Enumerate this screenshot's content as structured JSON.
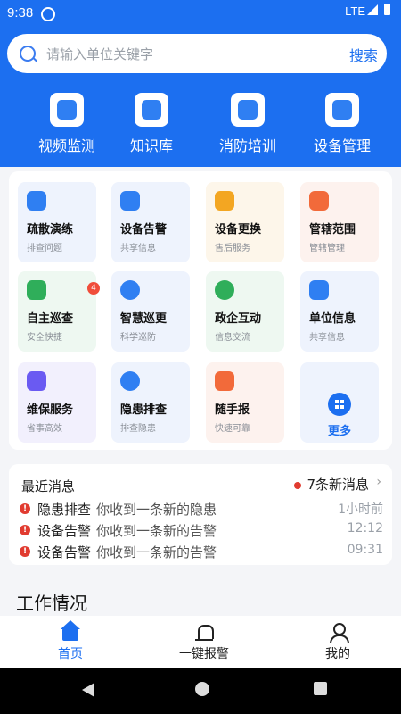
{
  "status": {
    "time": "9:38",
    "network": "LTE"
  },
  "search": {
    "placeholder": "请输入单位关键字",
    "button": "搜索"
  },
  "topnav": [
    {
      "label": "视频监测",
      "icon": "camera-icon"
    },
    {
      "label": "知识库",
      "icon": "library-icon"
    },
    {
      "label": "消防培训",
      "icon": "training-icon"
    },
    {
      "label": "设备管理",
      "icon": "box-icon"
    }
  ],
  "grid": [
    {
      "title": "疏散演练",
      "sub": "排查问题",
      "icon": "evacuation-icon",
      "bg": "#eef3fd",
      "ic": "#2f7ff2"
    },
    {
      "title": "设备告警",
      "sub": "共享信息",
      "icon": "bell-alarm-icon",
      "bg": "#eef3fd",
      "ic": "#2f7ff2"
    },
    {
      "title": "设备更换",
      "sub": "售后服务",
      "icon": "exchange-icon",
      "bg": "#fdf6ea",
      "ic": "#f3a622"
    },
    {
      "title": "管辖范围",
      "sub": "管辖管理",
      "icon": "map-pin-icon",
      "bg": "#fdf2ee",
      "ic": "#f26a3a"
    },
    {
      "title": "自主巡查",
      "sub": "安全快捷",
      "icon": "shield-icon",
      "bg": "#eef8f1",
      "ic": "#2fae5a"
    },
    {
      "title": "智慧巡更",
      "sub": "科学巡防",
      "icon": "s-circle-icon",
      "bg": "#eef3fd",
      "ic": "#2f7ff2"
    },
    {
      "title": "政企互动",
      "sub": "信息交流",
      "icon": "chat-icon",
      "bg": "#eef8f1",
      "ic": "#2fae5a"
    },
    {
      "title": "单位信息",
      "sub": "共享信息",
      "icon": "building-icon",
      "bg": "#eef3fd",
      "ic": "#2f7ff2"
    },
    {
      "title": "维保服务",
      "sub": "省事高效",
      "icon": "calendar-check-icon",
      "bg": "#f2f0fd",
      "ic": "#6a5af2"
    },
    {
      "title": "隐患排查",
      "sub": "排查隐患",
      "icon": "inspect-icon",
      "bg": "#eef3fd",
      "ic": "#2f7ff2"
    },
    {
      "title": "随手报",
      "sub": "快速可靠",
      "icon": "report-hand-icon",
      "bg": "#fdf2ee",
      "ic": "#f26a3a"
    }
  ],
  "badge": "4",
  "more": {
    "label": "更多"
  },
  "news": {
    "title": "最近消息",
    "new_count": "7条新消息",
    "items": [
      {
        "category": "隐患排查",
        "message": "你收到一条新的隐患",
        "time": "1小时前"
      },
      {
        "category": "设备告警",
        "message": "你收到一条新的告警",
        "time": "12:12"
      },
      {
        "category": "设备告警",
        "message": "你收到一条新的告警",
        "time": "09:31"
      }
    ]
  },
  "work_title": "工作情况",
  "tabs": [
    {
      "label": "首页"
    },
    {
      "label": "一键报警"
    },
    {
      "label": "我的"
    }
  ]
}
